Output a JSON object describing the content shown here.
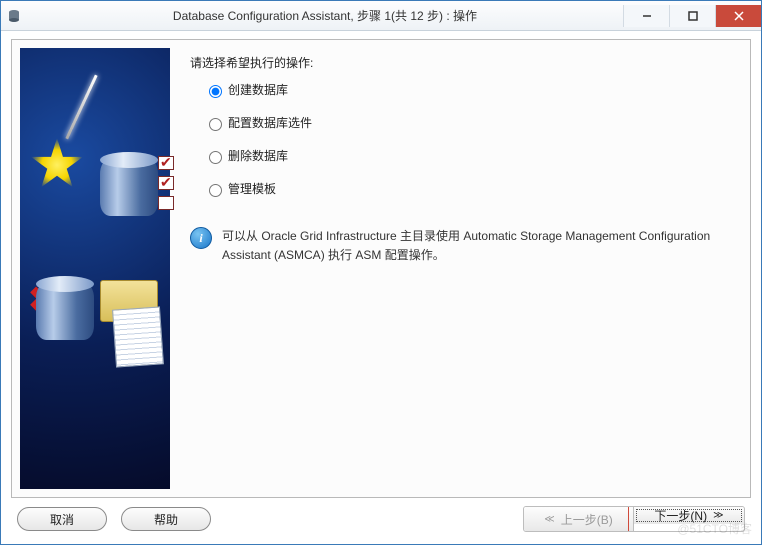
{
  "titlebar": {
    "title": "Database Configuration Assistant, 步骤 1(共 12 步) : 操作"
  },
  "content": {
    "prompt": "请选择希望执行的操作:",
    "options": [
      {
        "label": "创建数据库",
        "selected": true
      },
      {
        "label": "配置数据库选件",
        "selected": false
      },
      {
        "label": "删除数据库",
        "selected": false
      },
      {
        "label": "管理模板",
        "selected": false
      }
    ],
    "info": "可以从 Oracle Grid Infrastructure 主目录使用 Automatic Storage Management Configuration Assistant (ASMCA) 执行 ASM 配置操作。"
  },
  "buttons": {
    "cancel": "取消",
    "help": "帮助",
    "back": "上一步(B)",
    "next": "下一步(N)"
  },
  "watermark": "@51CTO博客"
}
